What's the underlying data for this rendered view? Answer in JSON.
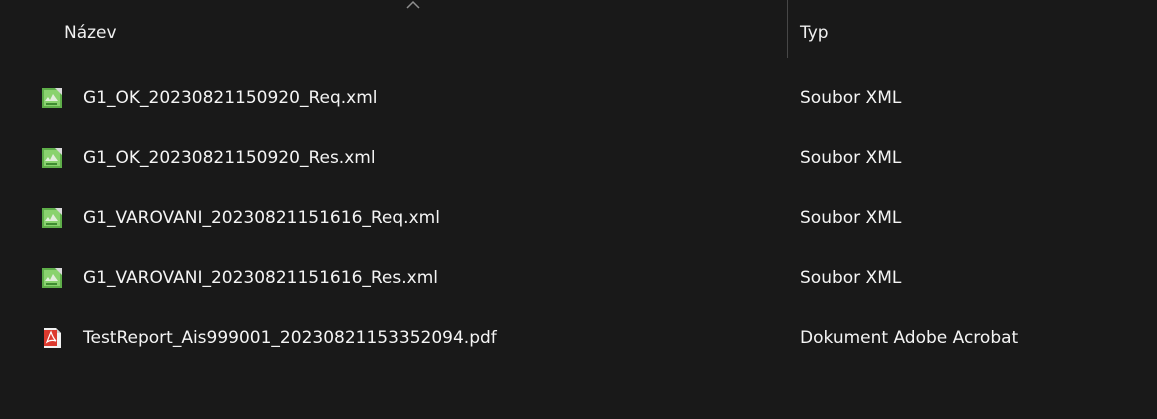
{
  "columns": {
    "name": "Název",
    "type": "Typ"
  },
  "files": [
    {
      "name": "G1_OK_20230821150920_Req.xml",
      "type": "Soubor XML",
      "icon": "xml-file-icon"
    },
    {
      "name": "G1_OK_20230821150920_Res.xml",
      "type": "Soubor XML",
      "icon": "xml-file-icon"
    },
    {
      "name": "G1_VAROVANI_20230821151616_Req.xml",
      "type": "Soubor XML",
      "icon": "xml-file-icon"
    },
    {
      "name": "G1_VAROVANI_20230821151616_Res.xml",
      "type": "Soubor XML",
      "icon": "xml-file-icon"
    },
    {
      "name": "TestReport_Ais999001_20230821153352094.pdf",
      "type": "Dokument Adobe Acrobat",
      "icon": "pdf-file-icon"
    }
  ],
  "colors": {
    "background": "#191919",
    "text": "#f4f4f4",
    "divider": "#474747",
    "xml_icon_green": "#65b84f",
    "pdf_icon_red": "#d9372b"
  }
}
